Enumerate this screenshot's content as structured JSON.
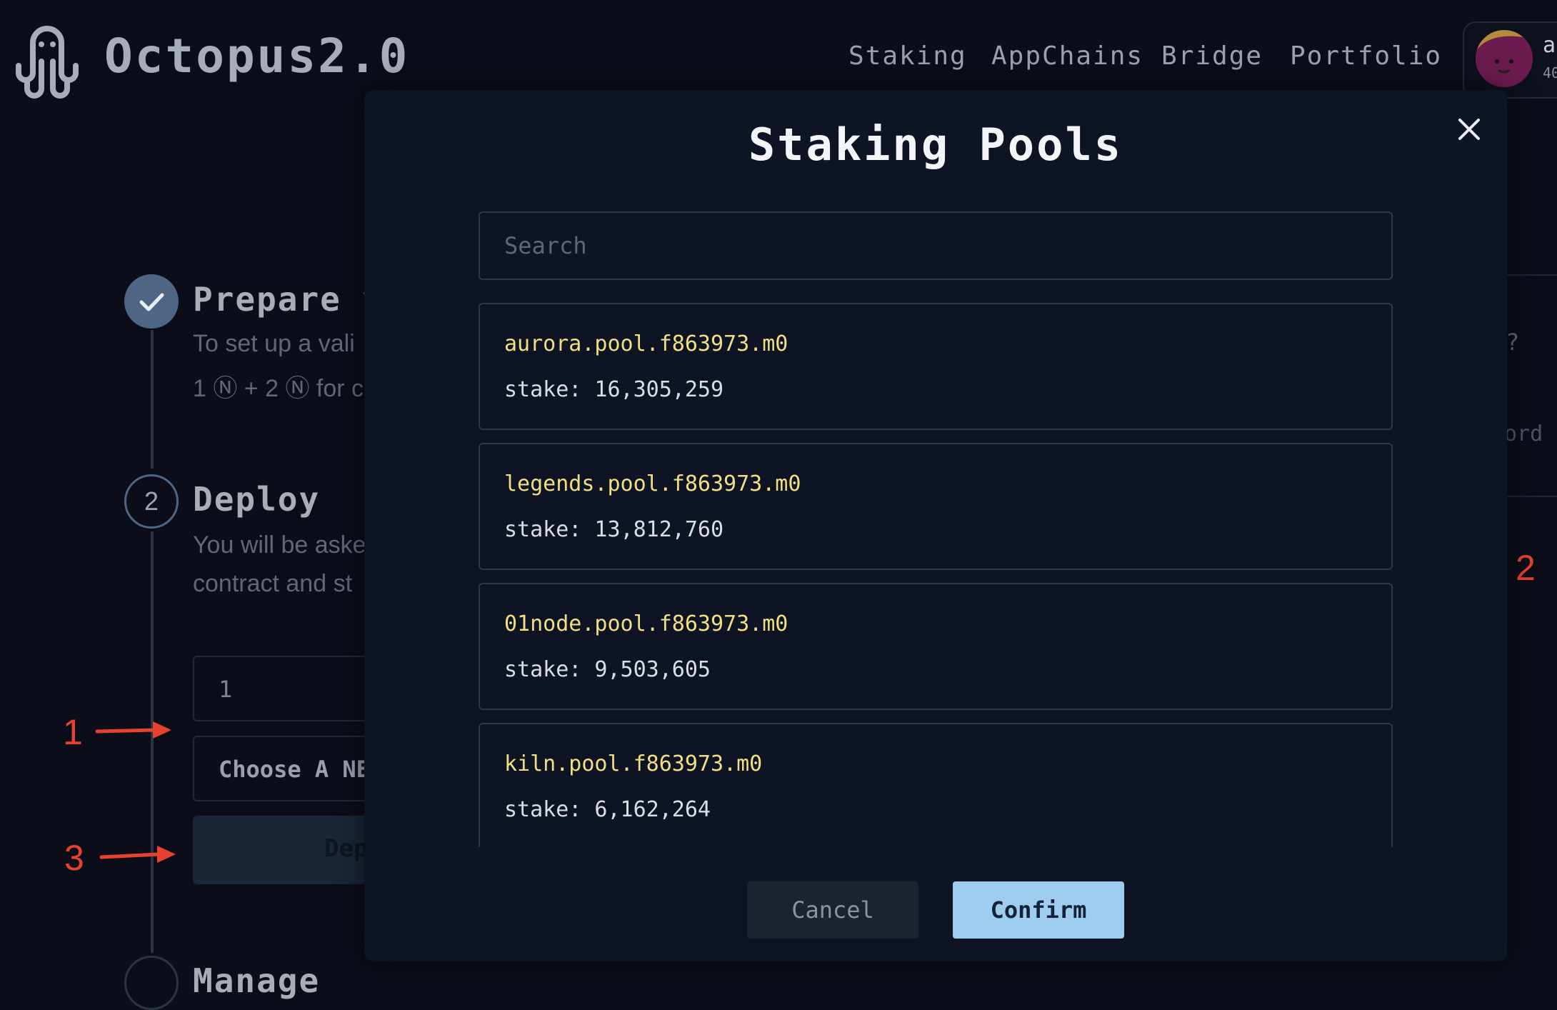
{
  "header": {
    "brand": "Octopus2.0",
    "nav": [
      "Staking",
      "AppChains",
      "Bridge",
      "Portfolio"
    ],
    "account": {
      "name_fragment": "a",
      "sub_fragment": "40"
    }
  },
  "background": {
    "step1": {
      "title": "Prepare y",
      "line1": "To set up a vali",
      "line2": "1 Ⓝ + 2 Ⓝ for c"
    },
    "step2": {
      "number": "2",
      "title": "Deploy",
      "line1": "You will be aske",
      "line2": "contract and st"
    },
    "input_value": "1",
    "choose_label": "Choose A NE",
    "deploy_label": "Dep",
    "right_fragment_1": "?",
    "right_fragment_2": "ord",
    "step3_title": "Manage"
  },
  "annotations": [
    "1",
    "2",
    "3"
  ],
  "modal": {
    "title": "Staking Pools",
    "search_placeholder": "Search",
    "pools": [
      {
        "name": "aurora.pool.f863973.m0",
        "stake": "stake: 16,305,259"
      },
      {
        "name": "legends.pool.f863973.m0",
        "stake": "stake: 13,812,760"
      },
      {
        "name": "01node.pool.f863973.m0",
        "stake": "stake: 9,503,605"
      },
      {
        "name": "kiln.pool.f863973.m0",
        "stake": "stake: 6,162,264"
      }
    ],
    "cancel_label": "Cancel",
    "confirm_label": "Confirm"
  },
  "colors": {
    "background": "#0b0e19",
    "modal": "#0f1424",
    "pool_name": "#f2df83",
    "confirm": "#9fcdf0",
    "annotation": "#e7422f"
  }
}
